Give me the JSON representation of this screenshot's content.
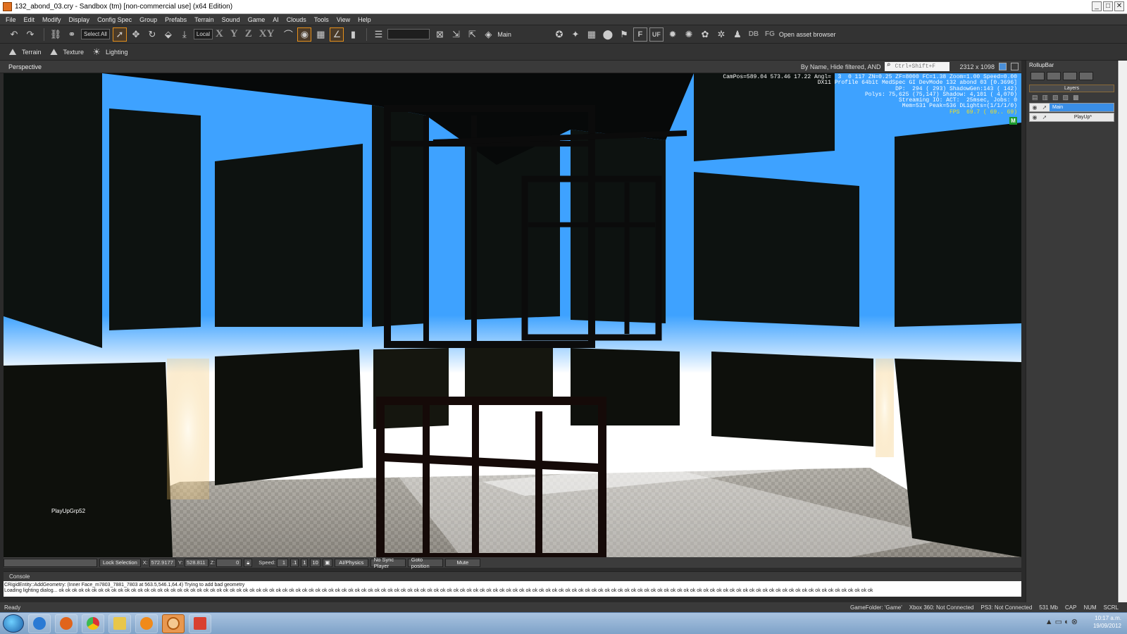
{
  "window": {
    "title": "132_abond_03.cry - Sandbox (tm) [non-commercial use] (x64 Edition)",
    "controls": [
      "_",
      "□",
      "✕"
    ]
  },
  "menu": [
    "File",
    "Edit",
    "Modify",
    "Display",
    "Config Spec",
    "Group",
    "Prefabs",
    "Terrain",
    "Sound",
    "Game",
    "AI",
    "Clouds",
    "Tools",
    "View",
    "Help"
  ],
  "toolbar": {
    "select_all": "Select All",
    "coord_system": "Local",
    "axes": [
      "X",
      "Y",
      "Z",
      "XY"
    ],
    "layer_name": "Main",
    "open_asset_browser": "Open asset browser",
    "letters": [
      "F",
      "UF",
      "DB",
      "FG"
    ]
  },
  "toolbar2": {
    "terrain": "Terrain",
    "texture": "Texture",
    "lighting": "Lighting"
  },
  "viewport": {
    "title": "Perspective",
    "filter_text": "By Name, Hide filtered, AND",
    "search_placeholder": "Ctrl+Shift+F",
    "resolution": "2312 x 1098",
    "overlay": [
      "CamPos=589.04 573.46 17.22 Angl=  3  0 117 ZN=0.25 ZF=8000 FC=1.38 Zoom=1.00 Speed=0.00",
      "DX11 Profile 64bit MedSpec GI DevMode 132 abond 03 [0.3696]",
      "DP:  294 ( 293) ShadowGen:143 ( 142)",
      "Polys: 75,625 (75,147) Shadow: 4,101 ( 4,070)",
      "Streaming IO: ACT:  25msec, Jobs: 0",
      "Mem=531 Peak=536 DLights=(1/1/1/0)"
    ],
    "fps": "FPS  69.7 ( 69.. 69)",
    "mode_badge": "M",
    "group_label": "PlayUpGrp52",
    "scene_colors": {
      "sky": "#3ea2ff",
      "glow": "#ffffff",
      "wall": "#0d1210",
      "floor": "#8c8880"
    }
  },
  "statusbar": {
    "lock_selection": "Lock Selection",
    "x_label": "X:",
    "x_value": "572.9177",
    "y_label": "Y:",
    "y_value": "528.811",
    "z_label": "Z:",
    "z_value": "0",
    "speed_label": "Speed:",
    "speed_value": "1",
    "speed_presets": [
      ".1",
      "1",
      "10"
    ],
    "ai_physics": "AI/Physics",
    "no_sync_player": "No Sync Player",
    "goto_position": "Goto position",
    "mute": "Mute"
  },
  "console": {
    "title": "Console",
    "lines": [
      "CRigidEntity::AddGeometry: (Inner Face_m7803_7881_7803 at 563.5,546.1,64.4) Trying to add bad geometry",
      "Loading lighting dialog... ok ok ok ok ok ok ok ok ok ok ok ok ok ok ok ok ok ok ok ok ok ok ok ok ok ok ok ok ok ok ok ok ok ok ok ok ok ok ok ok ok ok ok ok ok ok ok ok ok ok ok ok ok ok ok ok ok ok ok ok ok ok ok ok ok ok ok ok ok ok ok ok ok ok ok ok ok ok ok ok ok ok ok ok ok ok ok ok ok ok ok ok ok ok ok ok ok ok ok ok ok ok ok ok ok ok ok ok ok ok ok ok ok ok ok ok ok ok ok ok ok ok ok ok"
    ]
  },
  "status": {
    "ready": "Ready",
    "game_folder": "GameFolder: 'Game'",
    "xbox": "Xbox 360: Not Connected",
    "ps3": "PS3: Not Connected",
    "memory": "531 Mb",
    "cap": "CAP",
    "num": "NUM",
    "scrl": "SCRL"
  },
  "rollup": {
    "title": "RollupBar",
    "layers_title": "Layers",
    "layers": [
      {
        "name": "Main",
        "selected": true
      },
      {
        "name": "PlayUp*",
        "selected": false
      }
    ]
  },
  "taskbar": {
    "time": "10:17 a.m.",
    "date": "19/09/2012",
    "apps": [
      "windows-explorer",
      "internet-explorer",
      "firefox",
      "chrome",
      "file-explorer",
      "media-player",
      "sandbox",
      "paint"
    ]
  }
}
